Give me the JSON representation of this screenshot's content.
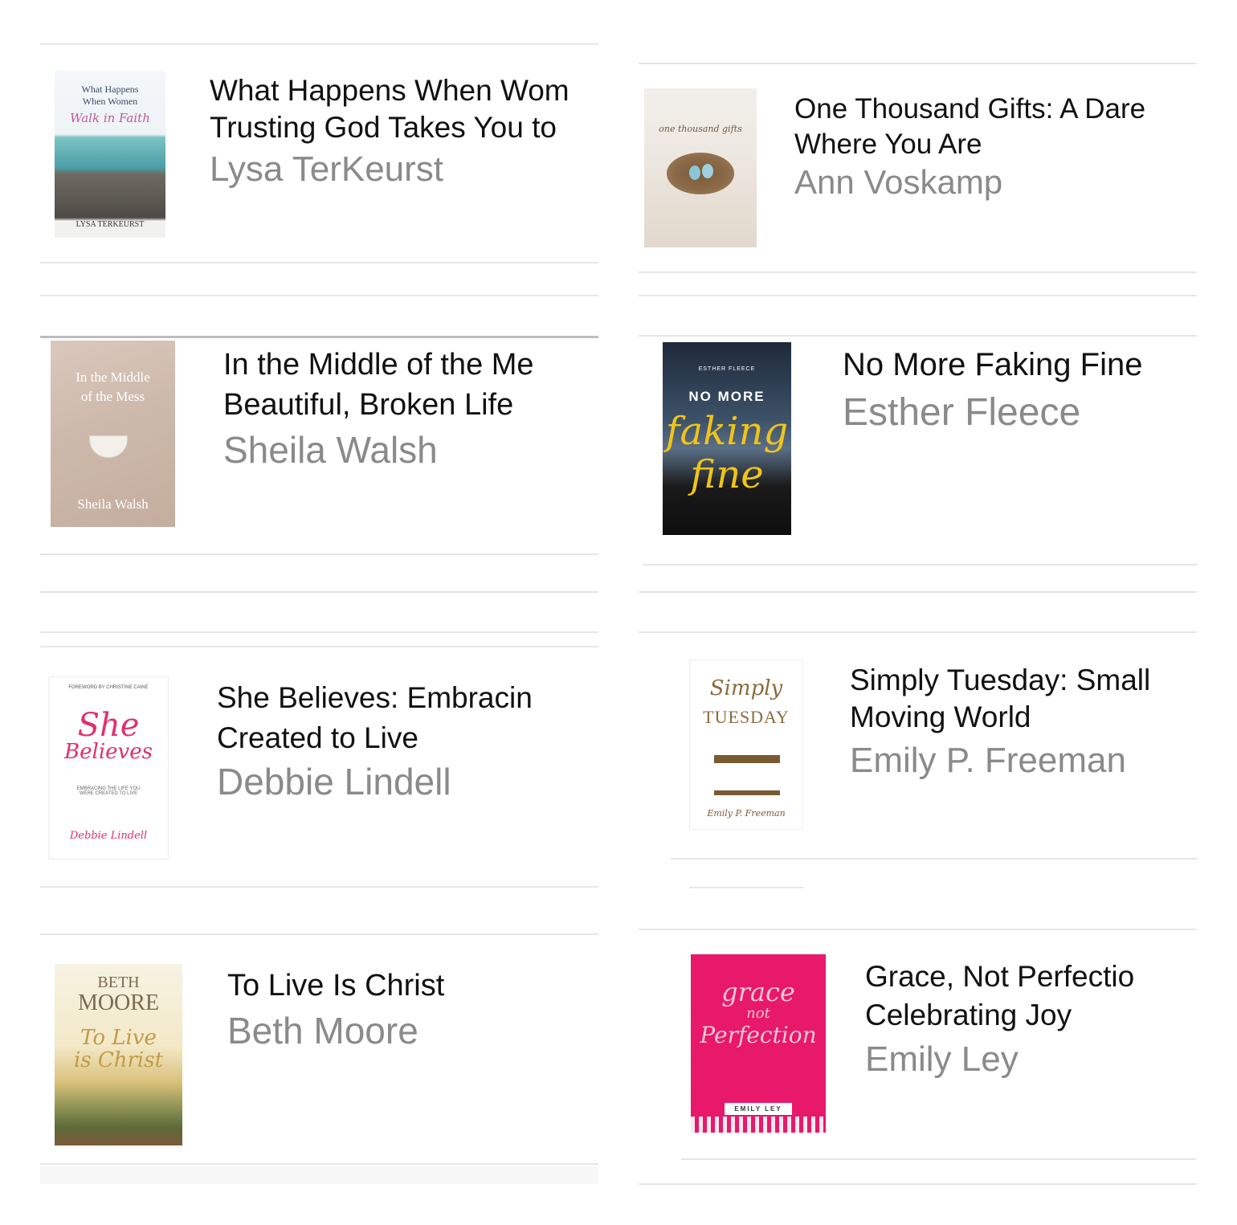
{
  "books": [
    {
      "title_line1": "What Happens When Wom",
      "title_line2": "Trusting God Takes You to",
      "author": "Lysa TerKeurst",
      "cover": {
        "line1": "What Happens",
        "line2": "When Women",
        "script": "Walk in Faith",
        "author": "Lysa TerKeurst"
      }
    },
    {
      "title_line1": "One Thousand Gifts: A Dare",
      "title_line2": "Where You Are",
      "author": "Ann Voskamp",
      "cover": {
        "script": "one thousand gifts"
      }
    },
    {
      "title_line1": "In the Middle of the Me",
      "title_line2": "Beautiful, Broken Life",
      "author": "Sheila Walsh",
      "cover": {
        "line1": "In the Middle",
        "line2": "of the Mess",
        "author": "Sheila Walsh"
      }
    },
    {
      "title_line1": "No More Faking Fine",
      "title_line2": "",
      "author": "Esther Fleece",
      "cover": {
        "top": "Esther Fleece",
        "line1": "NO MORE",
        "script1": "faking",
        "script2": "fine"
      }
    },
    {
      "title_line1": "She Believes: Embracin",
      "title_line2": "Created to Live",
      "author": "Debbie Lindell",
      "cover": {
        "top": "Foreword by Christine Caine",
        "script1": "She",
        "script2": "Believes",
        "sub": "Embracing the life you were created to live",
        "author": "Debbie Lindell"
      }
    },
    {
      "title_line1": "Simply Tuesday: Small",
      "title_line2": "Moving World",
      "author": "Emily P. Freeman",
      "cover": {
        "script": "Simply",
        "line1": "TUESDAY",
        "author": "Emily P. Freeman"
      }
    },
    {
      "title_line1": "To Live Is Christ",
      "title_line2": "",
      "author": "Beth Moore",
      "cover": {
        "line1": "BETH",
        "line2": "MOORE",
        "script1": "To Live",
        "script2": "is Christ"
      }
    },
    {
      "title_line1": "Grace, Not Perfectio",
      "title_line2": "Celebrating Joy",
      "author": "Emily Ley",
      "cover": {
        "script1": "grace",
        "script2": "not",
        "script3": "Perfection",
        "author": "EMILY LEY"
      }
    }
  ],
  "colors": {
    "title": "#111111",
    "author": "#8a8a8a",
    "divider": "#e6e6e6",
    "grace_pink": "#e8186a",
    "fleece_yellow": "#f0c419"
  }
}
